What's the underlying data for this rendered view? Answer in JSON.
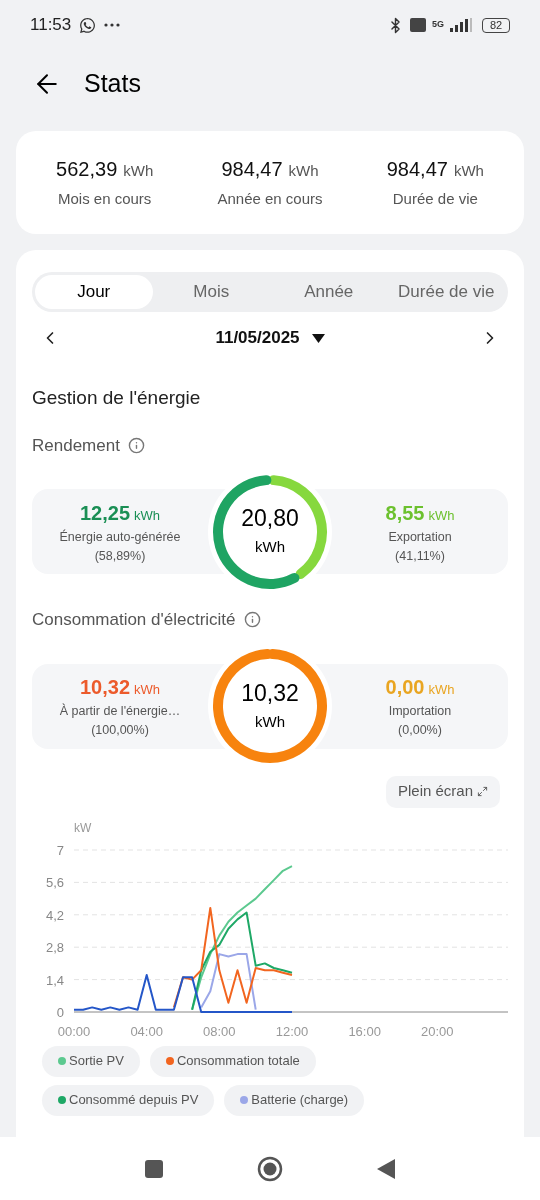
{
  "status_bar": {
    "time": "11:53",
    "network": "5G",
    "battery": "82"
  },
  "header": {
    "title": "Stats"
  },
  "summary": [
    {
      "value": "562,39",
      "unit": "kWh",
      "label": "Mois en cours"
    },
    {
      "value": "984,47",
      "unit": "kWh",
      "label": "Année en cours"
    },
    {
      "value": "984,47",
      "unit": "kWh",
      "label": "Durée de vie"
    }
  ],
  "tabs": [
    {
      "label": "Jour",
      "selected": true
    },
    {
      "label": "Mois",
      "selected": false
    },
    {
      "label": "Année",
      "selected": false
    },
    {
      "label": "Durée de vie",
      "selected": false
    }
  ],
  "date": "11/05/2025",
  "section_title": "Gestion de l'énergie",
  "panels": [
    {
      "title": "Rendement",
      "center_value": "20,80",
      "center_unit": "kWh",
      "left": {
        "value": "12,25",
        "unit": "kWh",
        "label": "Énergie auto-générée",
        "share": "(58,89%)",
        "color": "#1a8f55"
      },
      "right": {
        "value": "8,55",
        "unit": "kWh",
        "label": "Exportation",
        "share": "(41,11%)",
        "color": "#6cc12e"
      },
      "segments": [
        {
          "color": "#1fa463"
        },
        {
          "color": "#86d83e"
        }
      ]
    },
    {
      "title": "Consommation d'électricité",
      "center_value": "10,32",
      "center_unit": "kWh",
      "left": {
        "value": "10,32",
        "unit": "kWh",
        "label": "À partir de l'énergie…",
        "share": "(100,00%)",
        "color": "#ec5a2b"
      },
      "right": {
        "value": "0,00",
        "unit": "kWh",
        "label": "Importation",
        "share": "(0,00%)",
        "color": "#e9a521"
      },
      "segments": [
        {
          "color": "#f7830e"
        }
      ]
    }
  ],
  "chart": {
    "fullscreen_button": "Plein écran",
    "chart_data": {
      "type": "line",
      "ylabel": "kW",
      "grid": true,
      "xlim": [
        0,
        24
      ],
      "ylim": [
        0,
        7
      ],
      "xticks": [
        {
          "value": 0,
          "label": "00:00"
        },
        {
          "value": 4,
          "label": "04:00"
        },
        {
          "value": 8,
          "label": "08:00"
        },
        {
          "value": 12,
          "label": "12:00"
        },
        {
          "value": 16,
          "label": "16:00"
        },
        {
          "value": 20,
          "label": "20:00"
        }
      ],
      "yticks": [
        {
          "value": 0,
          "label": "0"
        },
        {
          "value": 1.4,
          "label": "1,4"
        },
        {
          "value": 2.8,
          "label": "2,8"
        },
        {
          "value": 4.2,
          "label": "4,2"
        },
        {
          "value": 5.6,
          "label": "5,6"
        },
        {
          "value": 7,
          "label": "7"
        }
      ],
      "x": [
        0,
        0.5,
        1,
        1.5,
        2,
        2.5,
        3,
        3.5,
        4,
        4.5,
        5,
        5.5,
        6,
        6.5,
        7,
        7.5,
        8,
        8.5,
        9,
        9.5,
        10,
        10.5,
        11,
        11.5,
        12
      ],
      "series": [
        {
          "name": "Sortie PV",
          "color": "#5cc98f",
          "values": [
            null,
            null,
            null,
            null,
            null,
            null,
            null,
            null,
            null,
            null,
            null,
            null,
            null,
            0.1,
            1.5,
            2.5,
            3.3,
            3.9,
            4.3,
            4.6,
            4.9,
            5.3,
            5.7,
            6.1,
            6.3
          ]
        },
        {
          "name": "Consommation totale",
          "color": "#f2651f",
          "values": [
            null,
            null,
            null,
            null,
            null,
            null,
            null,
            null,
            null,
            null,
            null,
            0.2,
            1.5,
            1.4,
            1.8,
            4.5,
            1.8,
            0.4,
            1.8,
            0.4,
            1.9,
            1.8,
            1.8,
            1.7,
            1.6
          ]
        },
        {
          "name": "Consommé depuis PV",
          "color": "#1ea866",
          "values": [
            null,
            null,
            null,
            null,
            null,
            null,
            null,
            null,
            null,
            null,
            null,
            null,
            null,
            0.1,
            1.8,
            2.6,
            2.9,
            3.6,
            4.0,
            4.3,
            2.0,
            2.1,
            1.9,
            1.8,
            1.7
          ]
        },
        {
          "name": "Batterie (charge)",
          "color": "#9ba7e8",
          "values": [
            null,
            null,
            null,
            null,
            null,
            null,
            null,
            null,
            null,
            null,
            null,
            null,
            null,
            null,
            0.2,
            0.9,
            2.5,
            2.4,
            2.5,
            2.5,
            0.1,
            null,
            null,
            null,
            null
          ]
        },
        {
          "color": "#2456c8",
          "values": [
            0.1,
            0.1,
            0.2,
            0.1,
            0.2,
            0.1,
            0.2,
            0.1,
            1.6,
            0.1,
            0.1,
            0.1,
            1.5,
            1.5,
            0,
            0,
            0,
            0,
            0,
            0,
            0,
            0,
            0,
            0,
            0
          ]
        }
      ]
    }
  }
}
